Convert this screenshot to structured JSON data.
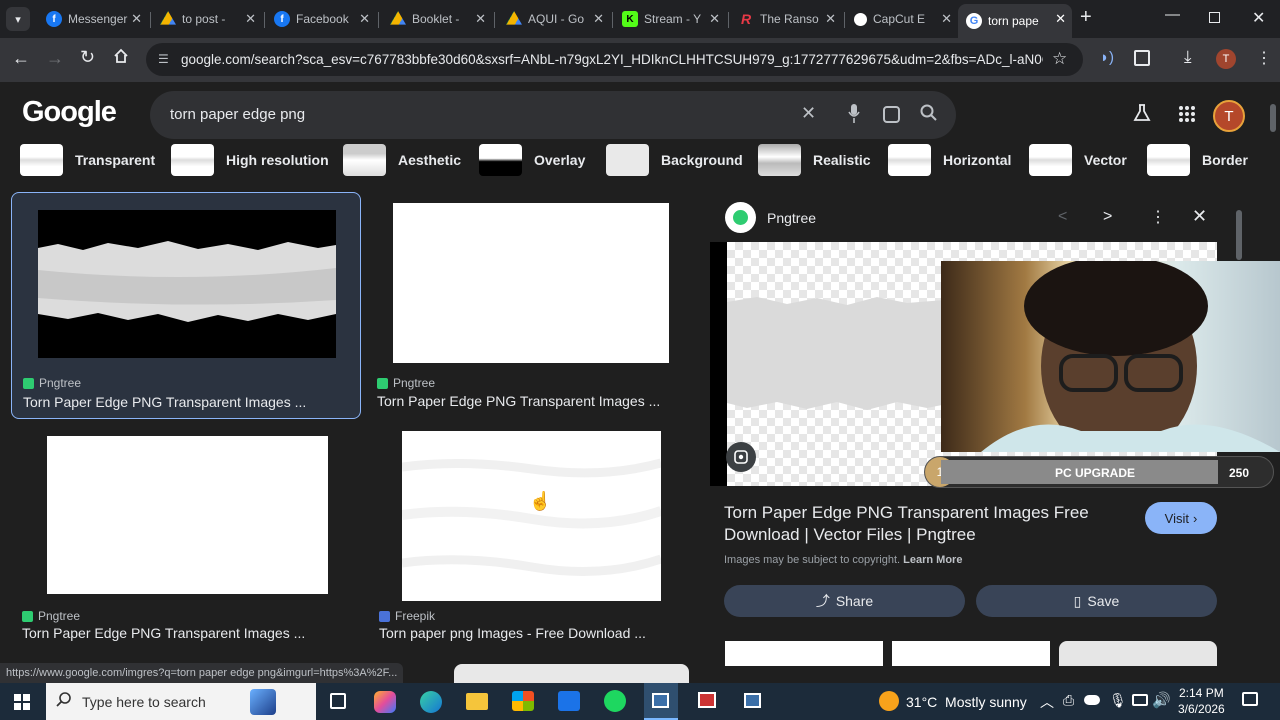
{
  "browser": {
    "tabs": [
      {
        "title": "Messenger",
        "icon": "facebook-icon",
        "color": "#1877f2"
      },
      {
        "title": "to post -",
        "icon": "drive-icon",
        "color": "#f4b400"
      },
      {
        "title": "Facebook",
        "icon": "facebook-icon",
        "color": "#1877f2"
      },
      {
        "title": "Booklet -",
        "icon": "drive-icon",
        "color": "#f4b400"
      },
      {
        "title": "AQUI - Go",
        "icon": "drive-icon",
        "color": "#f4b400"
      },
      {
        "title": "Stream - Y",
        "icon": "kick-icon",
        "color": "#53fc18"
      },
      {
        "title": "The Ranso",
        "icon": "r-icon",
        "color": "#e63946"
      },
      {
        "title": "CapCut E",
        "icon": "capcut-icon",
        "color": "#ffffff"
      },
      {
        "title": "torn pape",
        "icon": "google-icon",
        "color": "#ffffff"
      }
    ],
    "new_tab": "+",
    "url": "google.com/search?sca_esv=c767783bbfe30d60&sxsrf=ANbL-n79gxL2YI_HDIknCLHHTCSUH979_g:1772777629675&udm=2&fbs=ADc_l-aN0CWEZ...",
    "profile_letter": "T"
  },
  "google": {
    "logo": "Google",
    "query": "torn paper edge png",
    "avatar_letter": "T"
  },
  "chips": [
    "Transparent",
    "High resolution",
    "Aesthetic",
    "Overlay",
    "Background",
    "Realistic",
    "Horizontal",
    "Vector",
    "Border"
  ],
  "results": [
    {
      "source": "Pngtree",
      "caption": "Torn Paper Edge PNG Transparent Images ..."
    },
    {
      "source": "Pngtree",
      "caption": "Torn Paper Edge PNG Transparent Images ..."
    },
    {
      "source": "Pngtree",
      "caption": "Torn Paper Edge PNG Transparent Images ..."
    },
    {
      "source": "Freepik",
      "caption": "Torn paper png Images - Free Download ..."
    }
  ],
  "panel": {
    "source": "Pngtree",
    "title_line1": "Torn Paper Edge PNG Transparent Images Free",
    "title_line2": "Download | Vector Files | Pngtree",
    "copyright": "Images may be subject to copyright.",
    "learn_more": "Learn More",
    "visit": "Visit",
    "share": "Share",
    "save": "Save"
  },
  "overlay": {
    "badge": "1",
    "label": "PC UPGRADE",
    "count": "250"
  },
  "status_url": "https://www.google.com/imgres?q=torn paper edge png&imgurl=https%3A%2F...",
  "taskbar": {
    "search_placeholder": "Type here to search",
    "weather": "31°C  Mostly sunny",
    "time": "2:14 PM",
    "date": "3/6/2026"
  }
}
